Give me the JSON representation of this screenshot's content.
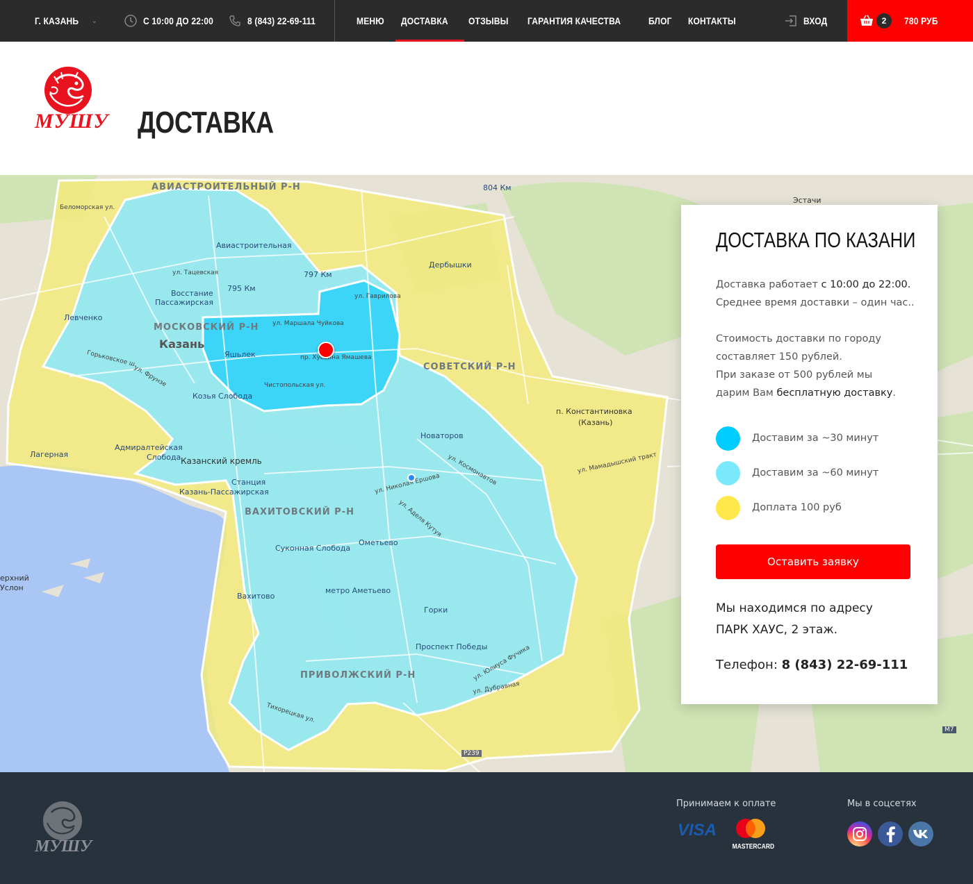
{
  "topbar": {
    "city": "Г. КАЗАНЬ",
    "hours": "С 10:00 ДО 22:00",
    "phone": "8 (843) 22-69-111",
    "nav": [
      {
        "label": "МЕНЮ",
        "active": false
      },
      {
        "label": "ДОСТАВКА",
        "active": true
      },
      {
        "label": "ОТЗЫВЫ",
        "active": false
      },
      {
        "label": "ГАРАНТИЯ КАЧЕСТВА",
        "active": false
      },
      {
        "label": "БЛОГ",
        "active": false
      },
      {
        "label": "КОНТАКТЫ",
        "active": false
      }
    ],
    "login": "ВХОД",
    "cart_count": "2",
    "cart_total": "780 РУБ",
    "accent": "#ff0000"
  },
  "header": {
    "logo_text": "МУШУ",
    "page_title": "ДОСТАВКА"
  },
  "map": {
    "labels": {
      "aviastroit_district": "АВИАСТРОИТЕЛЬНЫЙ Р-Н",
      "moskovsky_district": "МОСКОВСКИЙ Р-Н",
      "sovetsky_district": "СОВЕТСКИЙ Р-Н",
      "vakhitovsky_district": "ВАХИТОВСКИЙ Р-Н",
      "privolzhsky_district": "ПРИВОЛЖСКИЙ Р-Н",
      "kazan": "Казань",
      "konstantinovka": "п. Константиновка",
      "konstantinovka2": "(Казань)",
      "estachi": "Эстачи",
      "aviastroitelnaya": "Авиастроительная",
      "km797": "797 Км",
      "km795": "795 Км",
      "km804": "804 Км",
      "vosstanie": "Восстание",
      "vosstanie2": "Пассажирская",
      "levchenko": "Левченко",
      "yashlek": "Яшьлек",
      "kozya": "Козья Слобода",
      "admiralteyskaya": "Адмиралтейская",
      "admiralteyskaya2": "Слобода",
      "lagernaya": "Лагерная",
      "kremlin": "Казанский кремль",
      "stanciya": "Станция",
      "stanciya2": "Казань-Пассажирская",
      "novatorov": "Новаторов",
      "derbyshki": "Дербышки",
      "sukonnaya": "Суконная Слобода",
      "ometyevo": "Ометьево",
      "metro_ametyevo": "метро Аметьево",
      "gorki": "Горки",
      "prospekt_pobedy": "Проспект Победы",
      "vakhitovo": "Вахитово",
      "verkhny": "ерхний",
      "verkhny2": "Услон",
      "ul_tatsevskaya": "ул. Тацевская",
      "ul_marshala": "ул. Маршала Чуйкова",
      "ul_khusaina": "пр. Хусаина Ямашева",
      "ul_chistopolskaya": "Чистопольская ул.",
      "ul_gorkovskoe": "Горьковское ш.",
      "ul_amurskaya": "ул. Фрунзе",
      "ul_nikolaya": "ул. Николая Ершова",
      "ul_adelya": "ул. Аделя Кутуя",
      "ul_gavrilova": "ул. Гаврилова",
      "ul_belomorskaya": "Беломорская ул.",
      "ul_kosmonavtov": "ул. Космонавтов",
      "ul_yuliusa": "ул. Юлиуса Фучика",
      "ul_dubravnaya": "ул. Дубравная",
      "ul_tikoretskaya": "Тихорецкая ул.",
      "ul_mamadysh": "ул. Мамадышский тракт",
      "m7": "М7",
      "r239": "Р239"
    },
    "colors": {
      "zone_30": "#3cd4f7",
      "zone_60": "#8ee8f7",
      "zone_extra": "#f3ea7c"
    }
  },
  "card": {
    "title": "ДОСТАВКА ПО КАЗАНИ",
    "hours_prefix": "Доставка работает ",
    "hours_value": "с 10:00 до 22:00.",
    "avg_time": "Среднее время доставки – один час..",
    "cost_line1": "Стоимость доставки по городу",
    "cost_line2": "составляет 150 рублей.",
    "cost_line3": "При заказе от 500 рублей мы",
    "cost_line4_prefix": "дарим Вам ",
    "cost_line4_value": "бесплатную доставку",
    "cost_line4_suffix": ".",
    "legend": [
      {
        "label": "Доставим за ~30 минут",
        "color": "#00ccff"
      },
      {
        "label": "Доставим за ~60 минут",
        "color": "#7ae9fb"
      },
      {
        "label": "Доплата 100 руб",
        "color": "#ffe84a"
      }
    ],
    "button": "Оставить заявку",
    "address_line1": "Мы находимся по адресу",
    "address_line2": "ПАРК ХАУС, 2 этаж.",
    "phone_label": "Телефон: ",
    "phone_value": "8 (843) 22-69-111"
  },
  "footer": {
    "logo_text": "МУШУ",
    "payment_heading": "Принимаем к оплате",
    "visa": "VISA",
    "mastercard": "MASTERCARD",
    "social_heading": "Мы в соцсетях",
    "social": [
      {
        "name": "instagram-icon",
        "color": "#c13584"
      },
      {
        "name": "facebook-icon",
        "color": "#3b5998"
      },
      {
        "name": "vk-icon",
        "color": "#4a76a8"
      }
    ]
  }
}
